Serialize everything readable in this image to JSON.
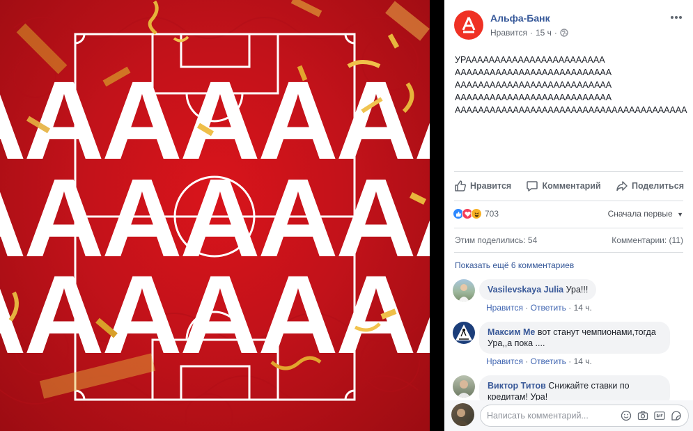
{
  "photo": {
    "letter": "A",
    "colors": {
      "red": "#c4121a",
      "white": "#ffffff",
      "gold": "#e0a830"
    }
  },
  "post": {
    "page_name": "Альфа-Банк",
    "avatar_letter": "А",
    "meta_like": "Нравится",
    "meta_sep": "·",
    "time": "15 ч",
    "text": "УРАААААААААААААААААААААААА\nААААААААААААААААААААААААААА\nААААААААААААААААААААААААААА\nААААААААААААААААААААААААААА\nАААААААААААААААААААААААААААААААААААААААА",
    "brand_color": "#ef3124"
  },
  "actions": {
    "like": "Нравится",
    "comment": "Комментарий",
    "share": "Поделиться"
  },
  "stats": {
    "reaction_count": "703",
    "sort": "Сначала первые",
    "shares": "Этим поделились: 54",
    "comments": "Комментарии: (11)",
    "show_more": "Показать ещё 6 комментариев"
  },
  "comments": [
    {
      "author": "Vasilevskaya Julia",
      "text": "Ура!!!",
      "like": "Нравится",
      "reply": "Ответить",
      "sep": "·",
      "time": "14 ч."
    },
    {
      "author": "Максим Ме",
      "text": "вот станут чемпионами,тогда Ура,,а пока ....",
      "like": "Нравится",
      "reply": "Ответить",
      "sep": "·",
      "time": "14 ч."
    },
    {
      "author": "Виктор Титов",
      "text": "Снижайте ставки по кредитам! Ура!",
      "like": "",
      "reply": "",
      "sep": "",
      "time": ""
    }
  ],
  "composer": {
    "placeholder": "Написать комментарий..."
  }
}
